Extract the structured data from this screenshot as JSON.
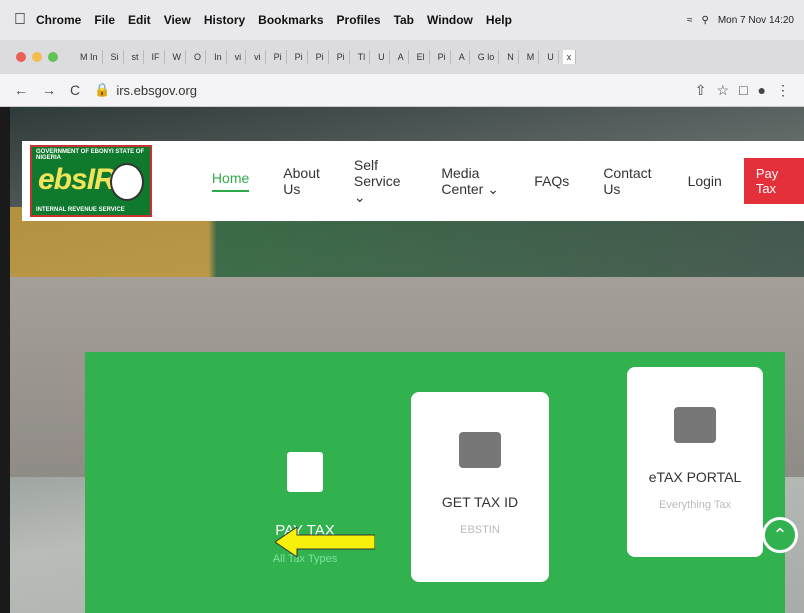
{
  "menubar": {
    "apple": "",
    "items": [
      "Chrome",
      "File",
      "Edit",
      "View",
      "History",
      "Bookmarks",
      "Profiles",
      "Tab",
      "Window",
      "Help"
    ],
    "clock": "Mon 7 Nov 14:20"
  },
  "tabs": [
    "M In",
    "Si",
    "st",
    "IF",
    "W",
    "O",
    "In",
    "vi",
    "vi",
    "Pi",
    "Pi",
    "Pi",
    "Pi",
    "Tl",
    "U",
    "A",
    "El",
    "Pi",
    "A",
    "G lo",
    "N",
    "M",
    "U",
    "x"
  ],
  "toolbar": {
    "back_icon": "←",
    "forward_icon": "→",
    "reload_icon": "C",
    "url": "irs.ebsgov.org"
  },
  "header": {
    "logo": {
      "gov_text": "GOVERNMENT OF EBONYI STATE OF NIGERIA",
      "brand": "ebsIRS",
      "irs_text": "INTERNAL REVENUE SERVICE"
    },
    "nav": {
      "home": "Home",
      "about": "About Us",
      "self_service": "Self Service ⌄",
      "media_center": "Media Center ⌄",
      "faqs": "FAQs",
      "contact": "Contact Us"
    },
    "login": "Login",
    "pay_tax": "Pay Tax"
  },
  "cards": {
    "pay": {
      "title": "PAY TAX",
      "sub": "All Tax Types"
    },
    "taxid": {
      "title": "GET TAX ID",
      "sub": "EBSTIN"
    },
    "etax": {
      "title": "eTAX PORTAL",
      "sub": "Everything Tax"
    }
  },
  "colors": {
    "brand_green": "#31b24e",
    "pay_tax_red": "#e3303a",
    "arrow_yellow": "#f7f00a"
  }
}
